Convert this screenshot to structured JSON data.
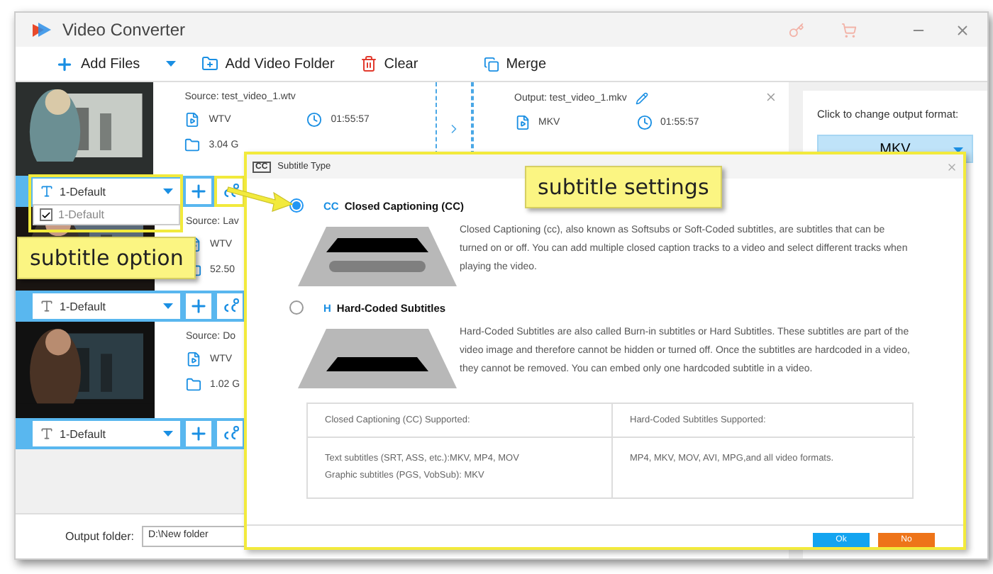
{
  "window": {
    "title": "Video Converter"
  },
  "toolbar": [
    {
      "label": "Add Files",
      "kind": "add"
    },
    {
      "label": "Add Video Folder",
      "kind": "folder"
    },
    {
      "label": "Clear",
      "kind": "clear"
    },
    {
      "label": "Merge",
      "kind": "merge"
    }
  ],
  "videos": [
    {
      "source": "Source: test_video_1.wtv",
      "format": "WTV",
      "duration": "01:55:57",
      "size": "3.04 G",
      "output": {
        "name": "Output: test_video_1.mkv",
        "format": "MKV",
        "duration": "01:55:57"
      },
      "subtitle": "1-Default",
      "menu": [
        {
          "label": "1-Default",
          "checked": true
        }
      ]
    },
    {
      "source": "Source: Lav",
      "format": "WTV",
      "size": "52.50",
      "subtitle": "1-Default"
    },
    {
      "source": "Source: Do",
      "format": "WTV",
      "size": "1.02 G",
      "subtitle": "1-Default"
    }
  ],
  "output_panel": {
    "hint": "Click to change output format:",
    "format": "MKV"
  },
  "output_folder": {
    "label": "Output folder:",
    "value": "D:\\New folder"
  },
  "dialog": {
    "icon_label": "CC",
    "title": "Subtitle Type",
    "options": [
      {
        "kind": "cc",
        "badge": "CC",
        "title": "Closed Captioning (CC)",
        "selected": true,
        "description": "Closed Captioning (cc), also known as Softsubs or Soft-Coded subtitles, are subtitles that can be turned on or off. You can add multiple closed caption tracks to a video and select different tracks when playing the video."
      },
      {
        "kind": "hard",
        "badge": "H",
        "title": "Hard-Coded Subtitles",
        "selected": false,
        "description": "Hard-Coded Subtitles are also called Burn-in subtitles or Hard Subtitles. These subtitles are part of the video image and therefore cannot be hidden or turned off. Once the subtitles are hardcoded in a video, they cannot be removed. You can embed only one hardcoded subtitle in a video."
      }
    ],
    "table": {
      "headers": [
        "Closed Captioning (CC) Supported:",
        "Hard-Coded Subtitles Supported:"
      ],
      "cells": [
        [
          "Text subtitles (SRT, ASS, etc.):MKV, MP4, MOV",
          "Graphic subtitles (PGS, VobSub): MKV"
        ],
        [
          "MP4, MKV, MOV, AVI, MPG,and all video formats."
        ]
      ]
    },
    "buttons": [
      {
        "label": "Ok",
        "kind": "primary"
      },
      {
        "label": "No",
        "kind": "cancel"
      }
    ]
  },
  "callouts": [
    {
      "text": "subtitle option"
    },
    {
      "text": "subtitle settings"
    }
  ]
}
